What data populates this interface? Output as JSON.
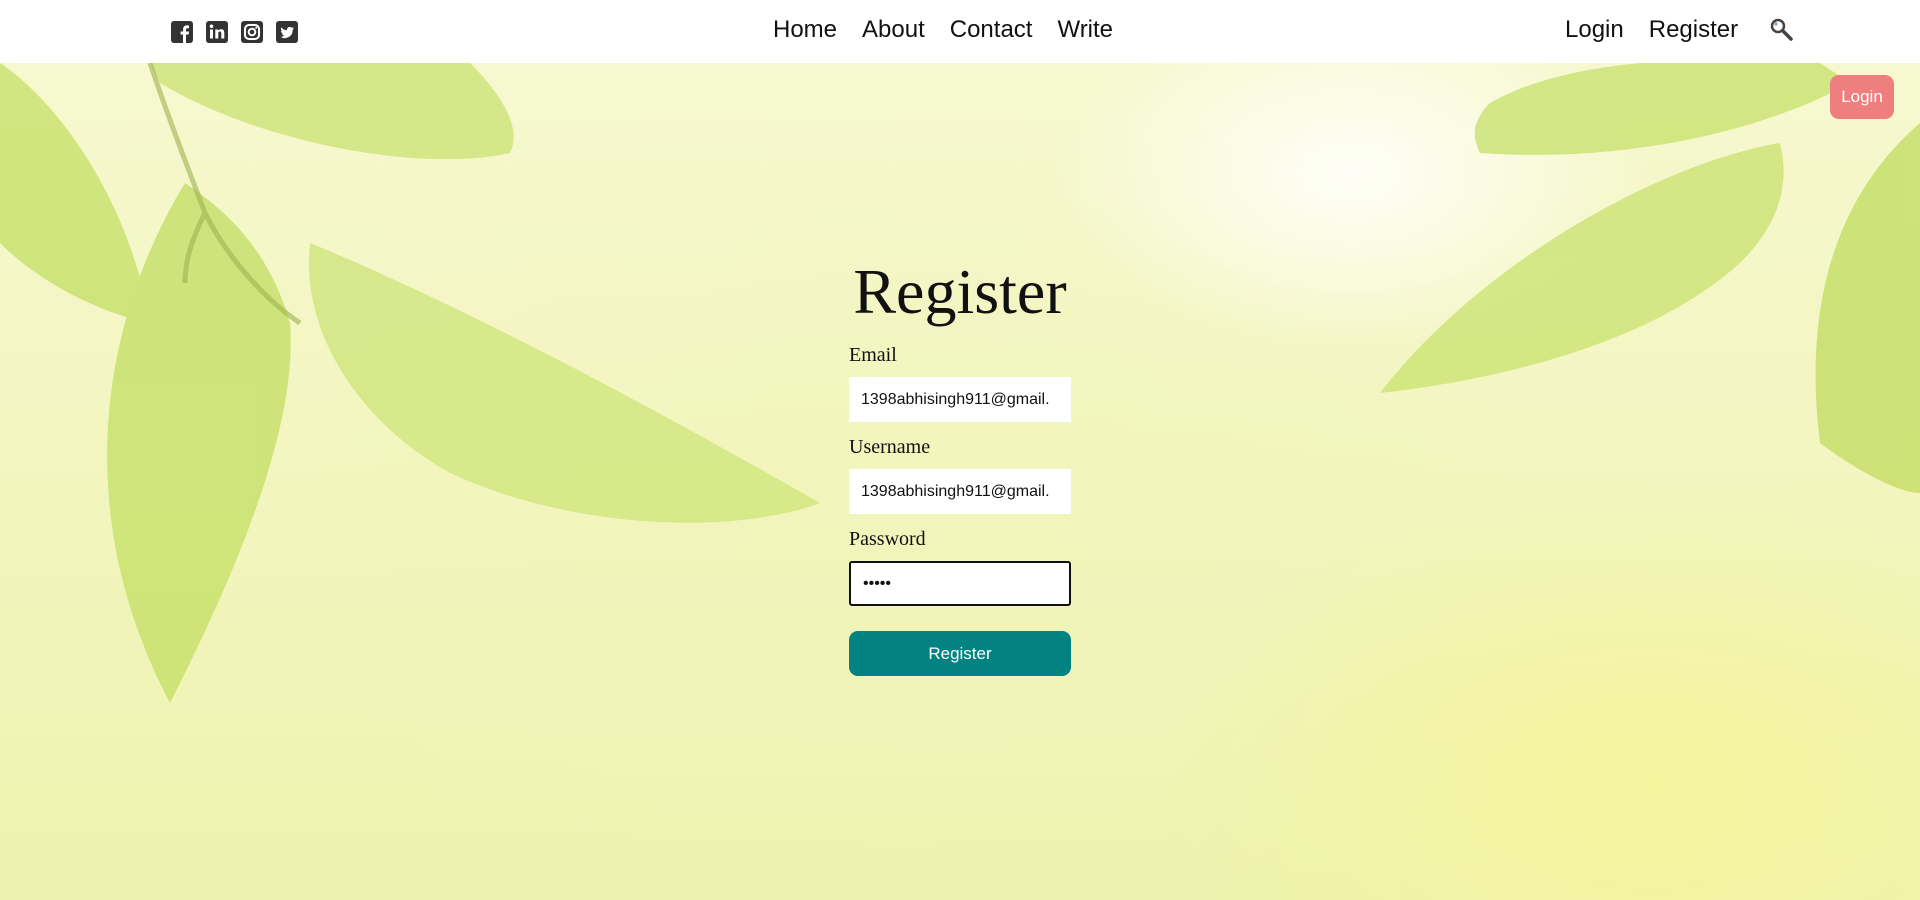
{
  "social": {
    "icons": [
      "facebook-square-icon",
      "linkedin-square-icon",
      "instagram-icon",
      "twitter-square-icon"
    ]
  },
  "nav": {
    "center": [
      "Home",
      "About",
      "Contact",
      "Write"
    ],
    "right": [
      "Login",
      "Register"
    ],
    "search_icon": "search-icon"
  },
  "login_pill": "Login",
  "form": {
    "title": "Register",
    "email_label": "Email",
    "email_value": "1398abhisingh911@gmail.",
    "username_label": "Username",
    "username_value": "1398abhisingh911@gmail.",
    "password_label": "Password",
    "password_value": "•••••",
    "submit_label": "Register"
  },
  "colors": {
    "login_pill": "#ef7f7f",
    "register_button": "#038282",
    "leaf": "#c8e06a"
  }
}
